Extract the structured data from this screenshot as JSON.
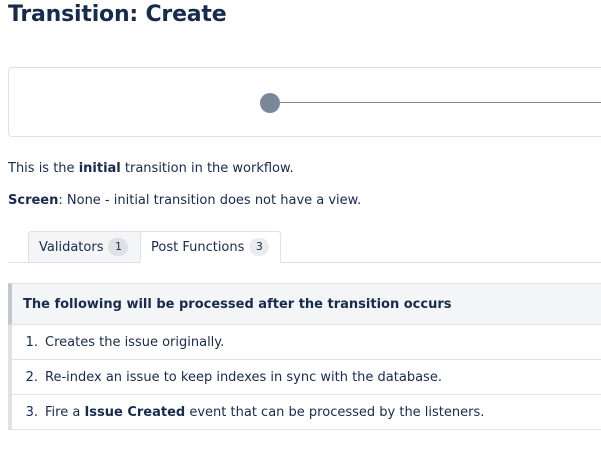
{
  "page": {
    "title": "Transition: Create"
  },
  "info": {
    "intro_prefix": "This is the ",
    "intro_bold": "initial",
    "intro_suffix": " transition in the workflow.",
    "screen_label": "Screen",
    "screen_value": ": None - initial transition does not have a view."
  },
  "tabs": [
    {
      "label": "Validators",
      "count": "1",
      "active": false
    },
    {
      "label": "Post Functions",
      "count": "3",
      "active": true
    }
  ],
  "post_functions": {
    "header": "The following will be processed after the transition occurs",
    "items": [
      {
        "num": "1.",
        "prefix": "Creates the issue originally.",
        "bold": "",
        "suffix": ""
      },
      {
        "num": "2.",
        "prefix": "Re-index an issue to keep indexes in sync with the database.",
        "bold": "",
        "suffix": ""
      },
      {
        "num": "3.",
        "prefix": "Fire a ",
        "bold": "Issue Created",
        "suffix": " event that can be processed by the listeners."
      }
    ]
  },
  "colors": {
    "text": "#172b4d",
    "diagram_node": "#7a869a",
    "border": "#dfe1e6",
    "header_bg": "#f4f5f7"
  }
}
